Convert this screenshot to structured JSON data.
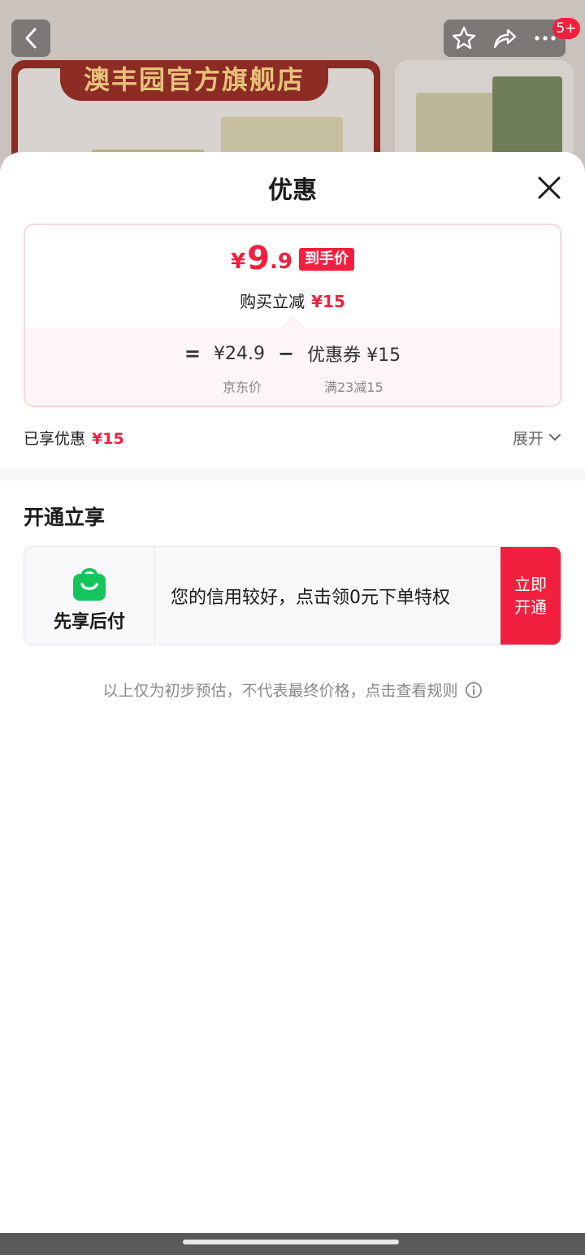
{
  "background": {
    "store_banner": "澳丰园官方旗舰店",
    "cart_badge": "5+"
  },
  "sheet": {
    "title": "优惠"
  },
  "price_card": {
    "currency": "¥",
    "price_int": "9",
    "price_dec": ".9",
    "price_tag": "到手价",
    "reduce_label": "购买立减",
    "reduce_amount": "¥15",
    "equals": "=",
    "jd_price": "¥24.9",
    "minus": "−",
    "coupon": "优惠券 ¥15",
    "jd_price_label": "京东价",
    "coupon_rule": "满23减15"
  },
  "enjoyed": {
    "label": "已享优惠",
    "amount": "¥15",
    "expand_label": "展开"
  },
  "open_section": {
    "title": "开通立享",
    "service_name": "先享后付",
    "promo_text": "您的信用较好，点击领0元下单特权",
    "button_line1": "立即",
    "button_line2": "开通"
  },
  "disclaimer": "以上仅为初步预估，不代表最终价格，点击查看规则",
  "colors": {
    "accent_red": "#f2203e",
    "bag_green": "#16c45c"
  }
}
